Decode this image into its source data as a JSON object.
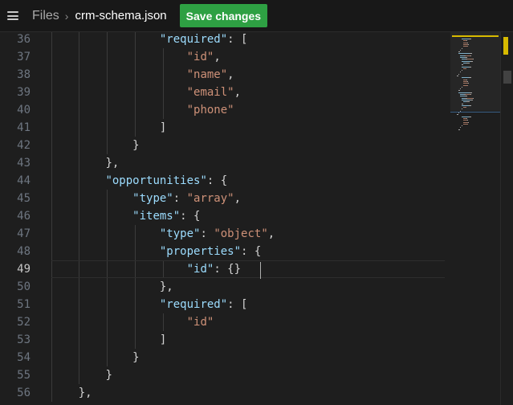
{
  "header": {
    "menu_icon": "hamburger-menu-icon",
    "breadcrumb_root": "Files",
    "breadcrumb_separator": "›",
    "file_name": "crm-schema.json",
    "save_label": "Save changes"
  },
  "editor": {
    "active_line": 49,
    "lines": [
      {
        "n": "36",
        "indent": 4,
        "tokens": [
          [
            "key",
            "\"required\""
          ],
          [
            "pun",
            ": ["
          ]
        ]
      },
      {
        "n": "37",
        "indent": 5,
        "tokens": [
          [
            "str",
            "\"id\""
          ],
          [
            "pun",
            ","
          ]
        ]
      },
      {
        "n": "38",
        "indent": 5,
        "tokens": [
          [
            "str",
            "\"name\""
          ],
          [
            "pun",
            ","
          ]
        ]
      },
      {
        "n": "39",
        "indent": 5,
        "tokens": [
          [
            "str",
            "\"email\""
          ],
          [
            "pun",
            ","
          ]
        ]
      },
      {
        "n": "40",
        "indent": 5,
        "tokens": [
          [
            "str",
            "\"phone\""
          ]
        ]
      },
      {
        "n": "41",
        "indent": 4,
        "tokens": [
          [
            "pun",
            "]"
          ]
        ]
      },
      {
        "n": "42",
        "indent": 3,
        "tokens": [
          [
            "pun",
            "}"
          ]
        ]
      },
      {
        "n": "43",
        "indent": 2,
        "tokens": [
          [
            "pun",
            "},"
          ]
        ]
      },
      {
        "n": "44",
        "indent": 2,
        "tokens": [
          [
            "key",
            "\"opportunities\""
          ],
          [
            "pun",
            ": {"
          ]
        ]
      },
      {
        "n": "45",
        "indent": 3,
        "tokens": [
          [
            "key",
            "\"type\""
          ],
          [
            "pun",
            ": "
          ],
          [
            "str",
            "\"array\""
          ],
          [
            "pun",
            ","
          ]
        ]
      },
      {
        "n": "46",
        "indent": 3,
        "tokens": [
          [
            "key",
            "\"items\""
          ],
          [
            "pun",
            ": {"
          ]
        ]
      },
      {
        "n": "47",
        "indent": 4,
        "tokens": [
          [
            "key",
            "\"type\""
          ],
          [
            "pun",
            ": "
          ],
          [
            "str",
            "\"object\""
          ],
          [
            "pun",
            ","
          ]
        ]
      },
      {
        "n": "48",
        "indent": 4,
        "tokens": [
          [
            "key",
            "\"properties\""
          ],
          [
            "pun",
            ": {"
          ]
        ]
      },
      {
        "n": "49",
        "indent": 5,
        "tokens": [
          [
            "key",
            "\"id\""
          ],
          [
            "pun",
            ": {}"
          ]
        ]
      },
      {
        "n": "50",
        "indent": 4,
        "tokens": [
          [
            "pun",
            "},"
          ]
        ]
      },
      {
        "n": "51",
        "indent": 4,
        "tokens": [
          [
            "key",
            "\"required\""
          ],
          [
            "pun",
            ": ["
          ]
        ]
      },
      {
        "n": "52",
        "indent": 5,
        "tokens": [
          [
            "str",
            "\"id\""
          ]
        ]
      },
      {
        "n": "53",
        "indent": 4,
        "tokens": [
          [
            "pun",
            "]"
          ]
        ]
      },
      {
        "n": "54",
        "indent": 3,
        "tokens": [
          [
            "pun",
            "}"
          ]
        ]
      },
      {
        "n": "55",
        "indent": 2,
        "tokens": [
          [
            "pun",
            "}"
          ]
        ]
      },
      {
        "n": "56",
        "indent": 1,
        "tokens": [
          [
            "pun",
            "},"
          ]
        ]
      }
    ]
  },
  "colors": {
    "key": "#9cdcfe",
    "string": "#ce9178",
    "punctuation": "#d4d4d4",
    "save_button": "#2ea043",
    "scroll_marker": "#d7ba00"
  }
}
